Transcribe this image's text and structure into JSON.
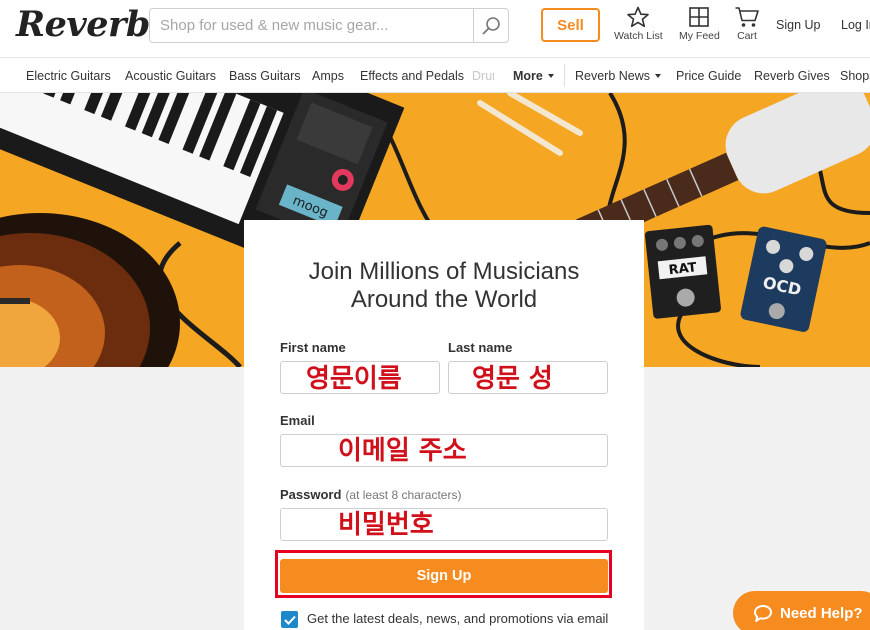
{
  "header": {
    "logo": "Reverb",
    "search_placeholder": "Shop for used & new music gear...",
    "search_icon": "search-icon",
    "sell_label": "Sell",
    "watch_list_label": "Watch List",
    "my_feed_label": "My Feed",
    "cart_label": "Cart",
    "sign_up_label": "Sign Up",
    "log_in_label": "Log In"
  },
  "nav": {
    "items": [
      "Electric Guitars",
      "Acoustic Guitars",
      "Bass Guitars",
      "Amps",
      "Effects and Pedals",
      "Drums"
    ],
    "more_label": "More",
    "reverb_news_label": "Reverb News",
    "price_guide_label": "Price Guide",
    "reverb_gives_label": "Reverb Gives",
    "shops_label": "Shops"
  },
  "hero": {
    "synth_brand": "moog",
    "pedal_1": "RAT",
    "pedal_2": "OCD"
  },
  "form": {
    "title_line1": "Join Millions of Musicians",
    "title_line2": "Around the World",
    "first_name_label": "First name",
    "last_name_label": "Last name",
    "email_label": "Email",
    "password_label": "Password",
    "password_hint": "(at least 8 characters)",
    "first_name_value": "",
    "last_name_value": "",
    "email_value": "",
    "password_value": "",
    "submit_label": "Sign Up",
    "deals_checkbox_label": "Get the latest deals, news, and promotions via email",
    "deals_checked": true
  },
  "annotations": {
    "first_name": "영문이름",
    "last_name": "영문 성",
    "email": "이메일 주소",
    "password": "비밀번호"
  },
  "help": {
    "label": "Need Help?"
  },
  "colors": {
    "accent": "#f68b1f",
    "hero_bg": "#f5a623",
    "annotation": "#d0101a",
    "checkbox": "#1e88c9"
  }
}
